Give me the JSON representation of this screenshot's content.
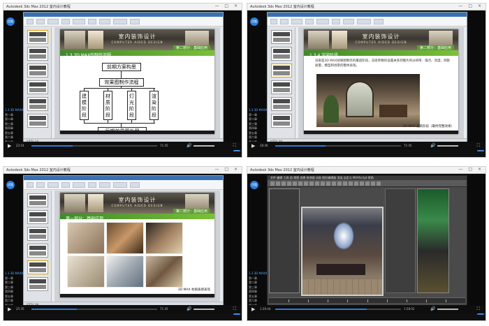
{
  "window_title": "Autodesk 3ds Max 2012 室内设计教程",
  "window_controls": "— □ ×",
  "logo_text": "优酷",
  "panels": [
    {
      "chapters": [
        "1.3 3D MAX的制作流程",
        "第一章",
        "第二章",
        "第三章",
        "第四章",
        "第五章",
        "第六章",
        "第七章",
        "第八章"
      ],
      "time": "23:54",
      "duration": "71:45",
      "progress": 0.33,
      "status": "幻灯片 1/2",
      "badge": "播放",
      "slide": {
        "head_title": "室内装饰设计",
        "head_sub": "COMPUTER AIDED DESIGN",
        "part_tag": "第二部分：基础应用",
        "section": "1.3 3D MAX的制作流程",
        "pre": "前期方案构思",
        "flow": "效果图制作流程",
        "stages": [
          "建模阶段",
          "材质阶段",
          "灯光阶段",
          "渲染阶段"
        ],
        "post": "后期效果图处理"
      }
    },
    {
      "time": "28:46",
      "duration": "71:45",
      "progress": 0.4,
      "status": "幻灯片 3/4",
      "slide": {
        "head_title": "室内装饰设计",
        "head_sub": "COMPUTER AIDED DESIGN",
        "part_tag": "第二部分：基础应用",
        "section": "1.3.4 渲染阶段",
        "paragraph": "渲染是3D MAX效果图制作的最后阶段，渲染参数的设置关系到图片的分辨率、噪点、亮度、阴影质量、模型和场景的整体表现。",
        "caption": "3D MAX 渲染阶段（最终完整效果）"
      }
    },
    {
      "time": "25:35",
      "duration": "71:45",
      "progress": 0.36,
      "status": "幻灯片 5/6",
      "slide": {
        "head_title": "室内装饰设计",
        "head_sub": "COMPUTER AIDED DESIGN",
        "part_tag": "第二部分：基础应用",
        "section": "第一部分：基础应用",
        "caption": "3D MAX 材质质感表现"
      }
    },
    {
      "time": "1:26:44",
      "duration": "1:58:02",
      "progress": 0.73,
      "max_menu": "文件 编辑 工具 组 视图 创建 修改器 动画 图形编辑器 渲染 自定义 MAXScript 帮助",
      "viewport_label": "Perspective"
    }
  ]
}
